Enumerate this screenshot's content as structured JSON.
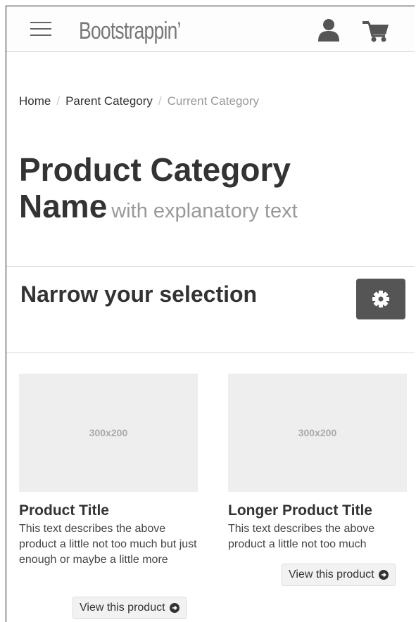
{
  "navbar": {
    "brand": "Bootstrappin’",
    "menu_icon": "hamburger-menu-icon",
    "user_icon": "user-icon",
    "cart_icon": "shopping-cart-icon"
  },
  "breadcrumb": {
    "items": [
      "Home",
      "Parent Category"
    ],
    "current": "Current Category",
    "separator": "/"
  },
  "page": {
    "title": "Product Category Name",
    "subtitle": "with explanatory text"
  },
  "filter": {
    "heading": "Narrow your selection",
    "settings_icon": "gear-icon"
  },
  "products": [
    {
      "image_label": "300x200",
      "title": "Product Title",
      "description": "This text describes the above product a little not too much but just enough or maybe a little more",
      "button_label": "View this product"
    },
    {
      "image_label": "300x200",
      "title": "Longer Product Title",
      "description": "This text describes the above product a little not too much",
      "button_label": "View this product"
    }
  ],
  "colors": {
    "brand": "#777777",
    "gear_button": "#555555",
    "placeholder": "#eeeeee",
    "muted": "#999999"
  }
}
